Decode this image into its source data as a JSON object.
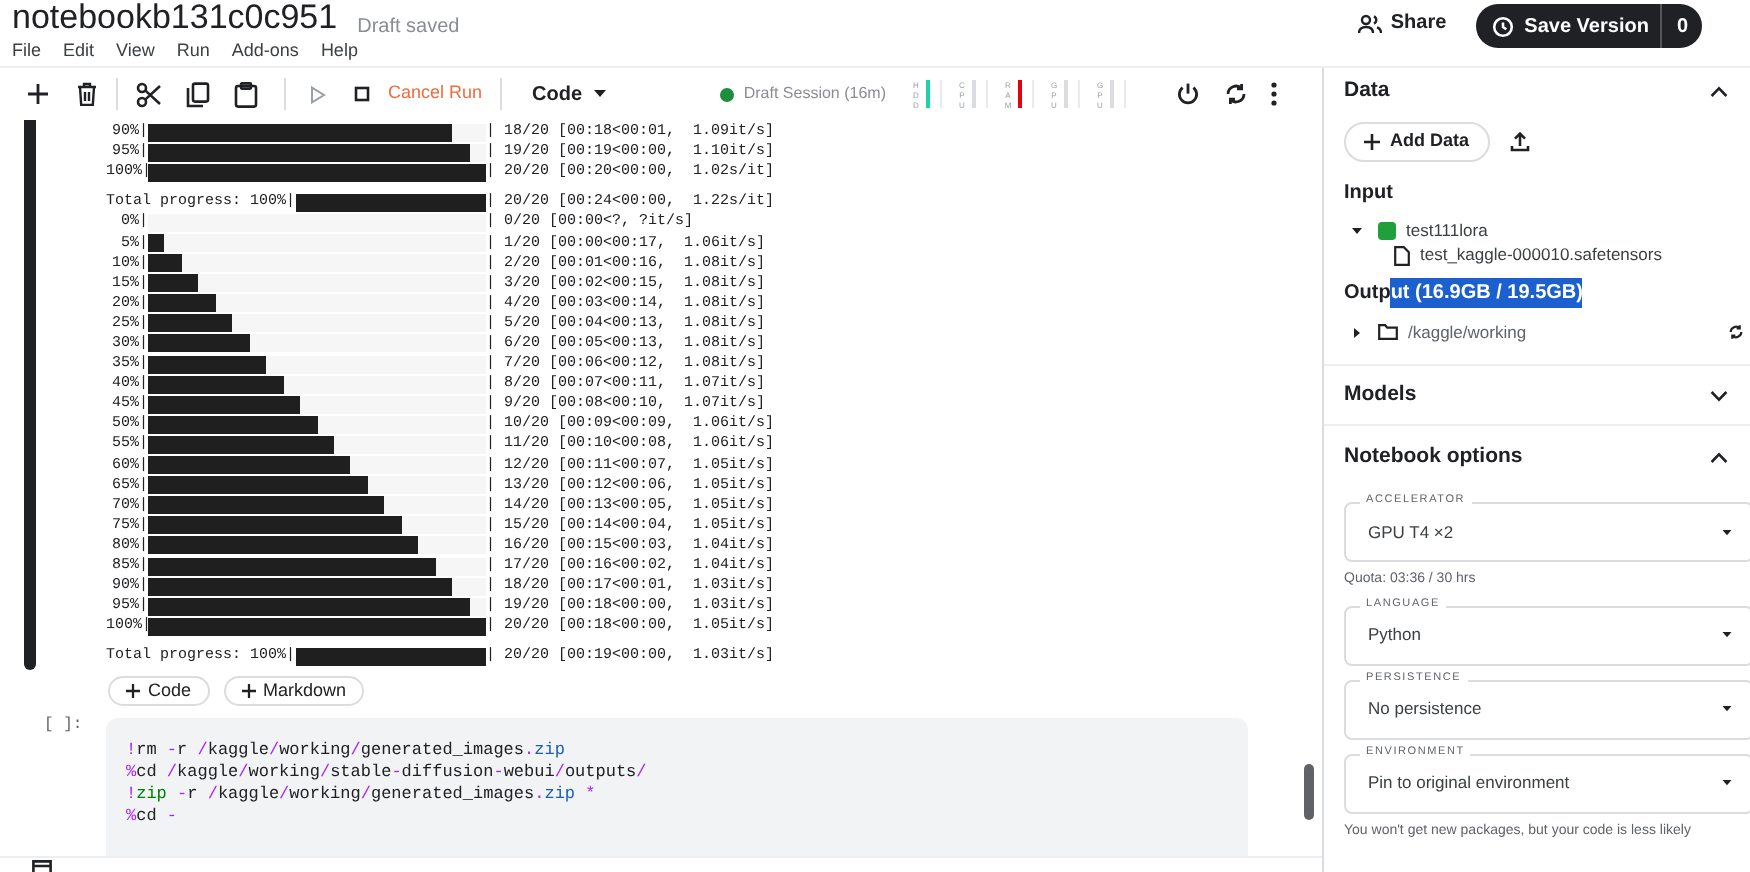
{
  "header": {
    "title": "notebookb131c0c951",
    "save_status": "Draft saved",
    "menu": [
      "File",
      "Edit",
      "View",
      "Run",
      "Add-ons",
      "Help"
    ],
    "share": "Share",
    "save_version": "Save Version",
    "version_count": "0"
  },
  "toolbar": {
    "cancel_run": "Cancel Run",
    "cell_type": "Code",
    "session": "Draft Session (16m)",
    "meters": [
      {
        "label": "HDD",
        "color": "#1dd3a7"
      },
      {
        "label": "CPU",
        "color": "#dadce0"
      },
      {
        "label": "RAM",
        "color": "#e8000b"
      },
      {
        "label": "GPU",
        "color": "#dadce0"
      },
      {
        "label": "GPU",
        "color": "#dadce0"
      }
    ]
  },
  "output": [
    {
      "kind": "step",
      "prefix": "90%|",
      "level": 0.9,
      "suffix": "| 18/20 [00:18<00:01,  1.09it/s]"
    },
    {
      "kind": "step",
      "prefix": "95%|",
      "level": 0.95,
      "suffix": "| 19/20 [00:19<00:00,  1.10it/s]"
    },
    {
      "kind": "step",
      "prefix": "100%|",
      "level": 1,
      "suffix": "| 20/20 [00:20<00:00,  1.02s/it]"
    },
    {
      "kind": "blank"
    },
    {
      "kind": "total",
      "prefix": "Total progress: 100%|",
      "level": 1,
      "suffix": "| 20/20 [00:24<00:00,  1.22s/it]"
    },
    {
      "kind": "step",
      "prefix": "0%|",
      "level": 0,
      "suffix": "| 0/20 [00:00<?, ?it/s]"
    },
    {
      "kind": "step",
      "prefix": "5%|",
      "level": 0.05,
      "suffix": "| 1/20 [00:00<00:17,  1.06it/s]"
    },
    {
      "kind": "step",
      "prefix": "10%|",
      "level": 0.1,
      "suffix": "| 2/20 [00:01<00:16,  1.08it/s]"
    },
    {
      "kind": "step",
      "prefix": "15%|",
      "level": 0.15,
      "suffix": "| 3/20 [00:02<00:15,  1.08it/s]"
    },
    {
      "kind": "step",
      "prefix": "20%|",
      "level": 0.2,
      "suffix": "| 4/20 [00:03<00:14,  1.08it/s]"
    },
    {
      "kind": "step",
      "prefix": "25%|",
      "level": 0.25,
      "suffix": "| 5/20 [00:04<00:13,  1.08it/s]"
    },
    {
      "kind": "step",
      "prefix": "30%|",
      "level": 0.3,
      "suffix": "| 6/20 [00:05<00:13,  1.08it/s]"
    },
    {
      "kind": "step",
      "prefix": "35%|",
      "level": 0.35,
      "suffix": "| 7/20 [00:06<00:12,  1.08it/s]"
    },
    {
      "kind": "step",
      "prefix": "40%|",
      "level": 0.4,
      "suffix": "| 8/20 [00:07<00:11,  1.07it/s]"
    },
    {
      "kind": "step",
      "prefix": "45%|",
      "level": 0.45,
      "suffix": "| 9/20 [00:08<00:10,  1.07it/s]"
    },
    {
      "kind": "step",
      "prefix": "50%|",
      "level": 0.5,
      "suffix": "| 10/20 [00:09<00:09,  1.06it/s]"
    },
    {
      "kind": "step",
      "prefix": "55%|",
      "level": 0.55,
      "suffix": "| 11/20 [00:10<00:08,  1.06it/s]"
    },
    {
      "kind": "step",
      "prefix": "60%|",
      "level": 0.6,
      "suffix": "| 12/20 [00:11<00:07,  1.05it/s]"
    },
    {
      "kind": "step",
      "prefix": "65%|",
      "level": 0.65,
      "suffix": "| 13/20 [00:12<00:06,  1.05it/s]"
    },
    {
      "kind": "step",
      "prefix": "70%|",
      "level": 0.7,
      "suffix": "| 14/20 [00:13<00:05,  1.05it/s]"
    },
    {
      "kind": "step",
      "prefix": "75%|",
      "level": 0.75,
      "suffix": "| 15/20 [00:14<00:04,  1.05it/s]"
    },
    {
      "kind": "step",
      "prefix": "80%|",
      "level": 0.8,
      "suffix": "| 16/20 [00:15<00:03,  1.04it/s]"
    },
    {
      "kind": "step",
      "prefix": "85%|",
      "level": 0.85,
      "suffix": "| 17/20 [00:16<00:02,  1.04it/s]"
    },
    {
      "kind": "step",
      "prefix": "90%|",
      "level": 0.9,
      "suffix": "| 18/20 [00:17<00:01,  1.03it/s]"
    },
    {
      "kind": "step",
      "prefix": "95%|",
      "level": 0.95,
      "suffix": "| 19/20 [00:18<00:00,  1.03it/s]"
    },
    {
      "kind": "step",
      "prefix": "100%|",
      "level": 1,
      "suffix": "| 20/20 [00:18<00:00,  1.05it/s]"
    },
    {
      "kind": "blank"
    },
    {
      "kind": "total",
      "prefix": "Total progress: 100%|",
      "level": 1,
      "suffix": "| 20/20 [00:19<00:00,  1.03it/s]"
    }
  ],
  "add_cell_buttons": [
    "Code",
    "Markdown"
  ],
  "code_cell": {
    "prompt": "[ ]:",
    "lines": [
      [
        {
          "kind": "op",
          "t": "!"
        },
        {
          "kind": "plain",
          "t": "rm "
        },
        {
          "kind": "op",
          "t": "-"
        },
        {
          "kind": "plain",
          "t": "r "
        },
        {
          "kind": "op",
          "t": "/"
        },
        {
          "kind": "plain",
          "t": "kaggle"
        },
        {
          "kind": "op",
          "t": "/"
        },
        {
          "kind": "plain",
          "t": "working"
        },
        {
          "kind": "op",
          "t": "/"
        },
        {
          "kind": "plain",
          "t": "generated_images"
        },
        {
          "kind": "op",
          "t": "."
        },
        {
          "kind": "attr",
          "t": "zip"
        }
      ],
      [
        {
          "kind": "op",
          "t": "%"
        },
        {
          "kind": "plain",
          "t": "cd "
        },
        {
          "kind": "op",
          "t": "/"
        },
        {
          "kind": "plain",
          "t": "kaggle"
        },
        {
          "kind": "op",
          "t": "/"
        },
        {
          "kind": "plain",
          "t": "working"
        },
        {
          "kind": "op",
          "t": "/"
        },
        {
          "kind": "plain",
          "t": "stable"
        },
        {
          "kind": "op",
          "t": "-"
        },
        {
          "kind": "plain",
          "t": "diffusion"
        },
        {
          "kind": "op",
          "t": "-"
        },
        {
          "kind": "plain",
          "t": "webui"
        },
        {
          "kind": "op",
          "t": "/"
        },
        {
          "kind": "plain",
          "t": "outputs"
        },
        {
          "kind": "op",
          "t": "/"
        }
      ],
      [
        {
          "kind": "op",
          "t": "!"
        },
        {
          "kind": "keyword",
          "t": "zip "
        },
        {
          "kind": "op",
          "t": "-"
        },
        {
          "kind": "plain",
          "t": "r "
        },
        {
          "kind": "op",
          "t": "/"
        },
        {
          "kind": "plain",
          "t": "kaggle"
        },
        {
          "kind": "op",
          "t": "/"
        },
        {
          "kind": "plain",
          "t": "working"
        },
        {
          "kind": "op",
          "t": "/"
        },
        {
          "kind": "plain",
          "t": "generated_images"
        },
        {
          "kind": "op",
          "t": "."
        },
        {
          "kind": "attr",
          "t": "zip "
        },
        {
          "kind": "op",
          "t": "*"
        }
      ],
      [
        {
          "kind": "op",
          "t": "%"
        },
        {
          "kind": "plain",
          "t": "cd "
        },
        {
          "kind": "op",
          "t": "-"
        }
      ]
    ]
  },
  "sidebar": {
    "data": {
      "title": "Data",
      "expanded": true,
      "add_data": "Add Data",
      "input_title": "Input",
      "input_tree": [
        {
          "label": "test111lora",
          "expanded": true,
          "children": [
            {
              "label": "test_kaggle-000010.safetensors"
            }
          ]
        }
      ],
      "output_title": [
        {
          "text": "Outp",
          "selected": false
        },
        {
          "text": "ut (16.9GB / 19.5GB)",
          "selected": true
        }
      ],
      "output_tree": [
        {
          "label": "/kaggle/working",
          "expanded": false
        }
      ]
    },
    "models": {
      "title": "Models",
      "expanded": false
    },
    "options": {
      "title": "Notebook options",
      "expanded": true,
      "fields": [
        {
          "label": "ACCELERATOR",
          "value": "GPU T4 ×2",
          "note": "Quota: 03:36 / 30 hrs"
        },
        {
          "label": "LANGUAGE",
          "value": "Python"
        },
        {
          "label": "PERSISTENCE",
          "value": "No persistence"
        },
        {
          "label": "ENVIRONMENT",
          "value": "Pin to original environment",
          "note": "You won't get new packages, but your code is less likely"
        }
      ]
    }
  }
}
